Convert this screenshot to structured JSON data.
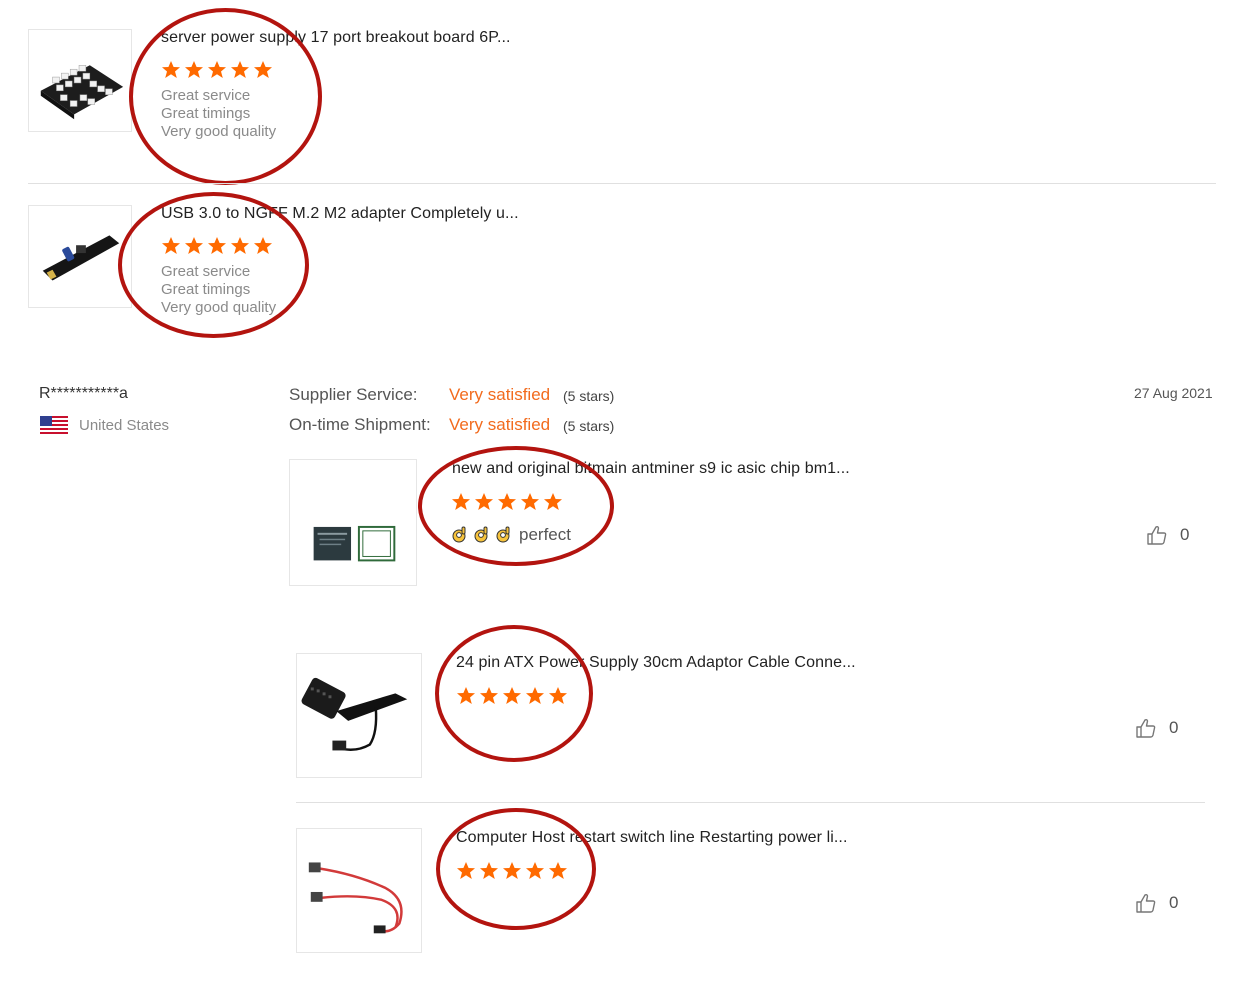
{
  "reviews_top": [
    {
      "title": "server power supply 17 port breakout board 6P...",
      "rating": 5,
      "lines": [
        "Great service",
        "Great timings",
        "Very good quality"
      ],
      "image": "breakout-board"
    },
    {
      "title": "USB 3.0 to NGFF M.2 M2 adapter Completely u...",
      "rating": 5,
      "lines": [
        "Great service",
        "Great timings",
        "Very good quality"
      ],
      "image": "m2-adapter"
    }
  ],
  "reviewer": {
    "name": "R***********a",
    "country": "United States",
    "date": "27 Aug 2021"
  },
  "supplier_service": {
    "label": "Supplier Service:",
    "value": "Very satisfied",
    "note": "(5 stars)"
  },
  "shipment": {
    "label": "On-time Shipment:",
    "value": "Very satisfied",
    "note": "(5 stars)"
  },
  "items": [
    {
      "title": "new and original bitmain antminer s9 ic asic chip bm1...",
      "rating": 5,
      "comment": "perfect",
      "emoji": "ok-hand-icon",
      "likes": "0",
      "image": "asic-chip"
    },
    {
      "title": "24 pin ATX Power Supply 30cm Adaptor Cable Conne...",
      "rating": 5,
      "likes": "0",
      "image": "atx-cable"
    },
    {
      "title": "Computer Host restart switch line Restarting power li...",
      "rating": 5,
      "likes": "0",
      "image": "switch-cable"
    }
  ],
  "colors": {
    "star": "#ff6a00",
    "accent": "#f26b1d",
    "annotation": "#b3140f"
  }
}
